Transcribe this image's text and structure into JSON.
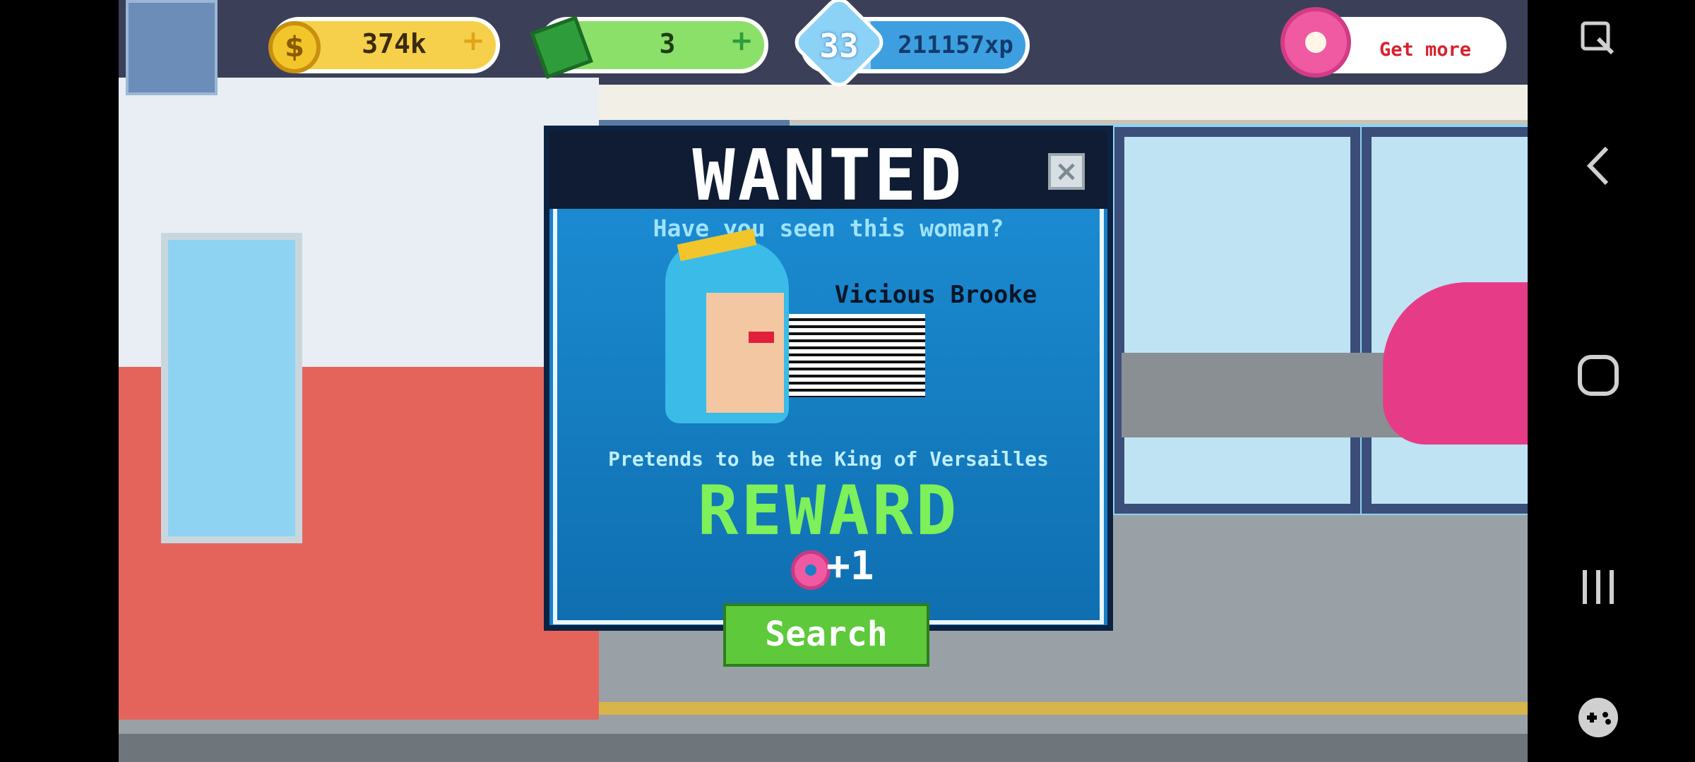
{
  "hud": {
    "coins": {
      "value": "374k",
      "plus_icon": "plus-icon",
      "icon": "coin-icon"
    },
    "cash": {
      "value": "3",
      "plus_icon": "plus-icon",
      "icon": "cash-icon"
    },
    "xp": {
      "level": "33",
      "value": "211157xp",
      "progress_fraction": 0.3
    },
    "donuts": {
      "cta": "Get more",
      "icon": "donut-icon"
    }
  },
  "modal": {
    "title": "WANTED",
    "question": "Have you seen this woman?",
    "suspect_name": "Vicious Brooke",
    "description": "Pretends to be the King of Versailles",
    "reward_title": "REWARD",
    "reward_amount": "+1",
    "search_label": "Search",
    "close_icon": "close-icon"
  },
  "system_nav": {
    "icons": [
      "screen-capture-icon",
      "back-icon",
      "home-icon",
      "recents-icon",
      "game-launcher-icon"
    ]
  },
  "colors": {
    "modal_bg": "#1880c9",
    "reward_green": "#7df05a",
    "search_green": "#5ec93b",
    "get_more_red": "#d5232f"
  }
}
